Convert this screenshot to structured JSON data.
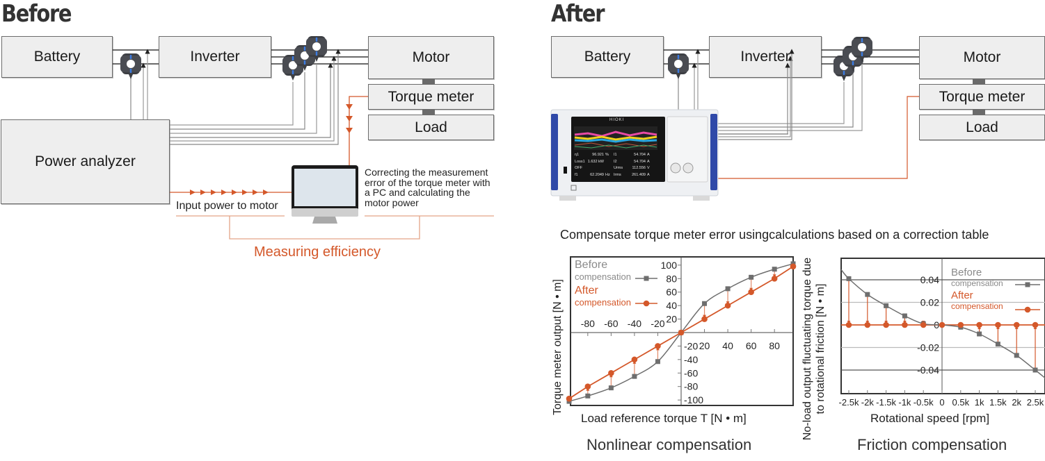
{
  "before": {
    "heading": "Before",
    "blocks": {
      "battery": "Battery",
      "inverter": "Inverter",
      "motor": "Motor",
      "torque_meter": "Torque meter",
      "load": "Load",
      "power_analyzer": "Power analyzer"
    },
    "input_power_label": "Input power to motor",
    "pc_note": [
      "Correcting the measurement",
      "error of the torque meter with",
      "a PC and calculating the",
      "motor power"
    ],
    "measuring_label": "Measuring efficiency"
  },
  "after": {
    "heading": "After",
    "blocks": {
      "battery": "Battery",
      "inverter": "Inverter",
      "motor": "Motor",
      "torque_meter": "Torque meter",
      "load": "Load"
    },
    "analyzer": {
      "brand": "HIOKI",
      "readings": [
        {
          "label": "η1",
          "value": "96.921",
          "unit": "%"
        },
        {
          "label": "Loss1",
          "value": "1.632 kW",
          "unit": ""
        },
        {
          "label": "OFF",
          "value": "",
          "unit": ""
        },
        {
          "label": "f1",
          "value": "62.2049",
          "unit": "Hz"
        }
      ],
      "readings_right": [
        {
          "label": "I1",
          "value": "54.704",
          "unit": "A"
        },
        {
          "label": "I2",
          "value": "54.704",
          "unit": "A"
        },
        {
          "label": "Urms",
          "value": "112.556",
          "unit": "V"
        },
        {
          "label": "Irms",
          "value": "261.409",
          "unit": "A"
        }
      ]
    },
    "subtitle": "Compensate torque meter error usingcalculations based on a correction table"
  },
  "colors": {
    "orange": "#d4582a",
    "gray_series": "#6e6e6e",
    "box_fill": "#eeeeee"
  },
  "chart_data": [
    {
      "type": "line",
      "title": "Nonlinear compensation",
      "xlabel": "Load reference torque T [N • m]",
      "ylabel": "Torque meter output [N • m]",
      "xlim": [
        -100,
        100
      ],
      "ylim": [
        -110,
        110
      ],
      "x_ticks": [
        -80,
        -60,
        -40,
        -20,
        20,
        40,
        60,
        80
      ],
      "y_ticks": [
        100,
        80,
        60,
        40,
        20,
        -20,
        -40,
        -60,
        -80,
        -100
      ],
      "grid": false,
      "legend": {
        "position": "top-left",
        "entries": [
          {
            "line1": "Before",
            "line2": "compensation"
          },
          {
            "line1": "After",
            "line2": "compensation"
          }
        ]
      },
      "series": [
        {
          "name": "Before compensation",
          "marker": "square",
          "x": [
            -96,
            -80,
            -60,
            -40,
            -20,
            0,
            20,
            40,
            60,
            80,
            96
          ],
          "y": [
            -102,
            -94,
            -82,
            -65,
            -43,
            0,
            43,
            65,
            82,
            94,
            102
          ]
        },
        {
          "name": "After compensation",
          "marker": "circle",
          "x": [
            -96,
            -80,
            -60,
            -40,
            -20,
            0,
            20,
            40,
            60,
            80,
            96
          ],
          "y": [
            -98,
            -80,
            -60,
            -40,
            -20,
            0,
            20,
            40,
            60,
            80,
            98
          ]
        }
      ]
    },
    {
      "type": "line",
      "title": "Friction compensation",
      "xlabel": "Rotational speed [rpm]",
      "ylabel": "No-load output fluctuating torque due to rotational friction [N • m]",
      "xlim": [
        -2900,
        2900
      ],
      "ylim": [
        -0.06,
        0.06
      ],
      "x_ticks": [
        "-2.5k",
        "-2k",
        "-1.5k",
        "-1k",
        "-0.5k",
        "0",
        "0.5k",
        "1k",
        "1.5k",
        "2k",
        "2.5k"
      ],
      "y_ticks": [
        0.04,
        0.02,
        0,
        -0.02,
        -0.04
      ],
      "grid": true,
      "legend": {
        "position": "top-right",
        "entries": [
          {
            "line1": "Before",
            "line2": "compensation"
          },
          {
            "line1": "After",
            "line2": "compensation"
          }
        ]
      },
      "series": [
        {
          "name": "Before compensation",
          "marker": "square",
          "x": [
            -2500,
            -2000,
            -1500,
            -1000,
            -500,
            0,
            500,
            1000,
            1500,
            2000,
            2500
          ],
          "y": [
            0.041,
            0.027,
            0.017,
            0.008,
            0.001,
            0,
            -0.002,
            -0.008,
            -0.017,
            -0.027,
            -0.04
          ]
        },
        {
          "name": "After compensation",
          "marker": "circle",
          "x": [
            -2500,
            -2000,
            -1500,
            -1000,
            -500,
            0,
            500,
            1000,
            1500,
            2000,
            2500
          ],
          "y": [
            0,
            0,
            0,
            0,
            0,
            0,
            0,
            0,
            0,
            0,
            0
          ]
        }
      ]
    }
  ]
}
